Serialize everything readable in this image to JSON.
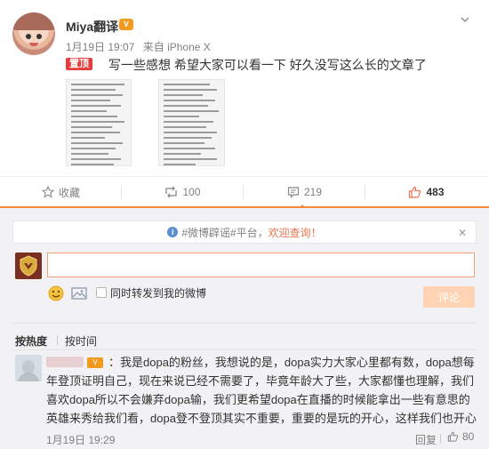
{
  "post": {
    "username": "Miya翻译",
    "vip_badge": "V",
    "date": "1月19日 19:07",
    "source": "来自 iPhone X",
    "topped_label": "置顶",
    "text": "写一些感想 希望大家可以看一下 好久没写这么长的文章了",
    "image_count": 2
  },
  "actions": {
    "favorite_label": "收藏",
    "reposts": "100",
    "comments": "219",
    "likes": "483"
  },
  "comment_box": {
    "rumor_prefix": "#微博辟谣#平台，",
    "rumor_link": "欢迎查询！",
    "close": "✕",
    "input_value": "",
    "repost_label": "同时转发到我的微博",
    "submit_label": "评论"
  },
  "sort": {
    "hot": "按热度",
    "time": "按时间"
  },
  "comments": [
    {
      "badge": "V",
      "text": "：我是dopa的粉丝，我想说的是，dopa实力大家心里都有数，dopa想每年登顶证明自己，现在来说已经不需要了，毕竟年龄大了些，大家都懂也理解，我们喜欢dopa所以不会嫌弃dopa输，我们更希望dopa在直播的时候能拿出一些有意思的英雄来秀给我们看，dopa登不登顶其实不重要，重要的是玩的开心，这样我们也开心",
      "time": "1月19日 19:29",
      "reply_label": "回复",
      "likes": "80"
    }
  ],
  "colors": {
    "accent": "#f7883b",
    "topped": "#e73c3c",
    "link": "#eb7350"
  }
}
